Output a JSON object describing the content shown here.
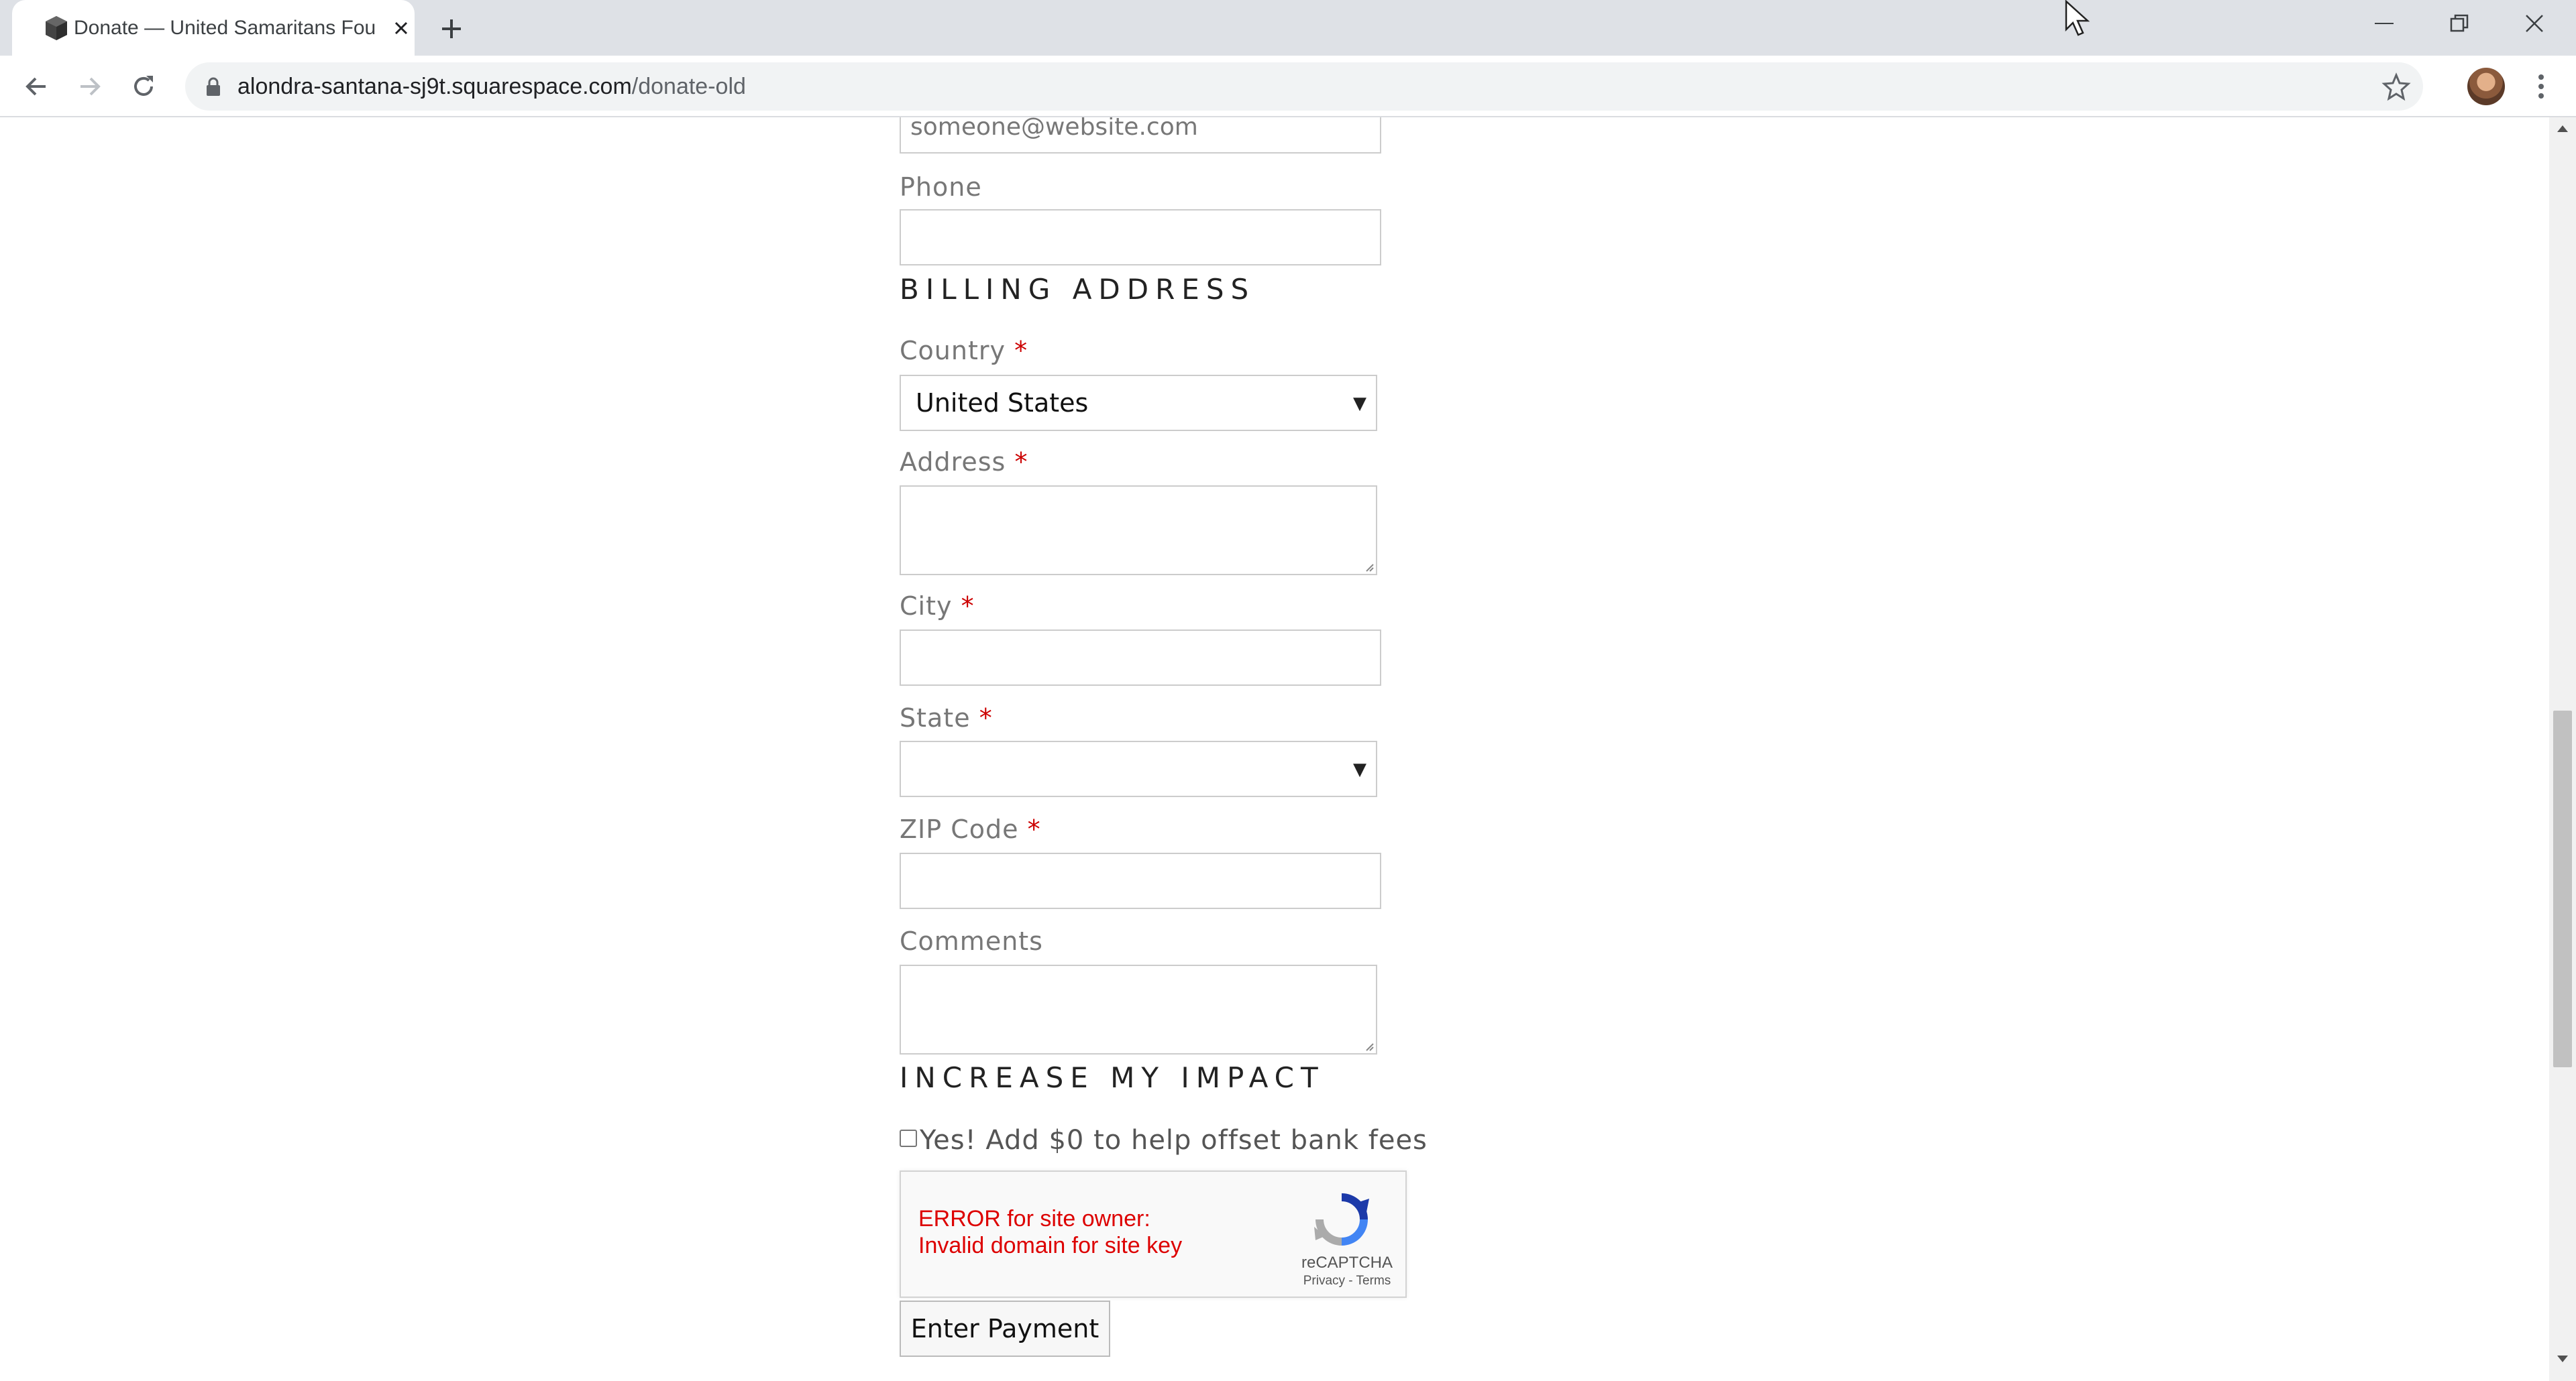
{
  "browser": {
    "tab_title": "Donate — United Samaritans Fou",
    "url_host": "alondra-santana-sj9t.squarespace.com",
    "url_path": "/donate-old"
  },
  "form": {
    "email_value": "someone@website.com",
    "phone_label": "Phone",
    "billing_heading": "BILLING ADDRESS",
    "country_label": "Country",
    "country_value": "United States",
    "address_label": "Address",
    "city_label": "City",
    "state_label": "State",
    "state_value": "",
    "zip_label": "ZIP Code",
    "comments_label": "Comments",
    "impact_heading": "INCREASE MY IMPACT",
    "fee_checkbox_label": "Yes! Add $0 to help offset bank fees",
    "fee_checked": false,
    "required_mark": "*",
    "submit_label": "Enter Payment"
  },
  "recaptcha": {
    "error_line1": "ERROR for site owner:",
    "error_line2": "Invalid domain for site key",
    "brand": "reCAPTCHA",
    "links": "Privacy - Terms"
  },
  "colors": {
    "required": "#cc0000",
    "error": "#dd0000",
    "chrome_bg": "#dee1e6"
  }
}
